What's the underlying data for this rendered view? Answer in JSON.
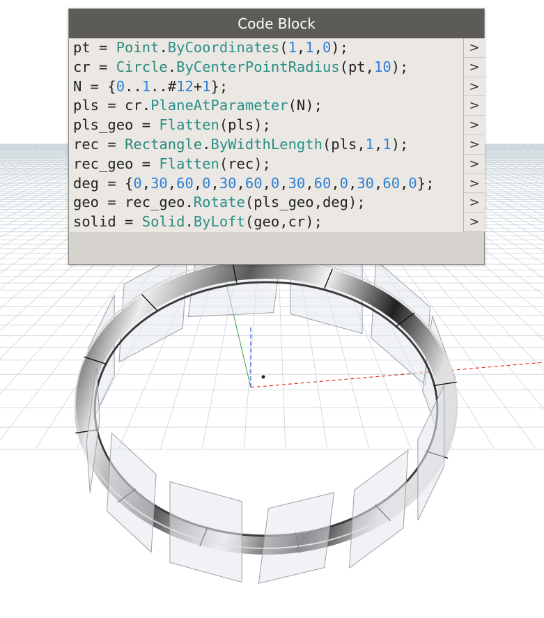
{
  "node": {
    "title": "Code Block",
    "lines": [
      [
        {
          "t": "pt = ",
          "c": "plain"
        },
        {
          "t": "Point",
          "c": "cls"
        },
        {
          "t": ".",
          "c": "plain"
        },
        {
          "t": "ByCoordinates",
          "c": "fn"
        },
        {
          "t": "(",
          "c": "plain"
        },
        {
          "t": "1",
          "c": "num"
        },
        {
          "t": ",",
          "c": "plain"
        },
        {
          "t": "1",
          "c": "num"
        },
        {
          "t": ",",
          "c": "plain"
        },
        {
          "t": "0",
          "c": "num"
        },
        {
          "t": ");",
          "c": "plain"
        }
      ],
      [
        {
          "t": "cr = ",
          "c": "plain"
        },
        {
          "t": "Circle",
          "c": "cls"
        },
        {
          "t": ".",
          "c": "plain"
        },
        {
          "t": "ByCenterPointRadius",
          "c": "fn"
        },
        {
          "t": "(pt,",
          "c": "plain"
        },
        {
          "t": "10",
          "c": "num"
        },
        {
          "t": ");",
          "c": "plain"
        }
      ],
      [
        {
          "t": "N = {",
          "c": "plain"
        },
        {
          "t": "0",
          "c": "num"
        },
        {
          "t": "..",
          "c": "plain"
        },
        {
          "t": "1",
          "c": "num"
        },
        {
          "t": "..#",
          "c": "plain"
        },
        {
          "t": "12",
          "c": "num"
        },
        {
          "t": "+",
          "c": "plain"
        },
        {
          "t": "1",
          "c": "num"
        },
        {
          "t": "};",
          "c": "plain"
        }
      ],
      [
        {
          "t": "pls = cr.",
          "c": "plain"
        },
        {
          "t": "PlaneAtParameter",
          "c": "fn"
        },
        {
          "t": "(N);",
          "c": "plain"
        }
      ],
      [
        {
          "t": "pls_geo = ",
          "c": "plain"
        },
        {
          "t": "Flatten",
          "c": "fn"
        },
        {
          "t": "(pls);",
          "c": "plain"
        }
      ],
      [
        {
          "t": "rec = ",
          "c": "plain"
        },
        {
          "t": "Rectangle",
          "c": "cls"
        },
        {
          "t": ".",
          "c": "plain"
        },
        {
          "t": "ByWidthLength",
          "c": "fn"
        },
        {
          "t": "(pls,",
          "c": "plain"
        },
        {
          "t": "1",
          "c": "num"
        },
        {
          "t": ",",
          "c": "plain"
        },
        {
          "t": "1",
          "c": "num"
        },
        {
          "t": ");",
          "c": "plain"
        }
      ],
      [
        {
          "t": "rec_geo = ",
          "c": "plain"
        },
        {
          "t": "Flatten",
          "c": "fn"
        },
        {
          "t": "(rec);",
          "c": "plain"
        }
      ],
      [
        {
          "t": "deg = {",
          "c": "plain"
        },
        {
          "t": "0",
          "c": "num"
        },
        {
          "t": ",",
          "c": "plain"
        },
        {
          "t": "30",
          "c": "num"
        },
        {
          "t": ",",
          "c": "plain"
        },
        {
          "t": "60",
          "c": "num"
        },
        {
          "t": ",",
          "c": "plain"
        },
        {
          "t": "0",
          "c": "num"
        },
        {
          "t": ",",
          "c": "plain"
        },
        {
          "t": "30",
          "c": "num"
        },
        {
          "t": ",",
          "c": "plain"
        },
        {
          "t": "60",
          "c": "num"
        },
        {
          "t": ",",
          "c": "plain"
        },
        {
          "t": "0",
          "c": "num"
        },
        {
          "t": ",",
          "c": "plain"
        },
        {
          "t": "30",
          "c": "num"
        },
        {
          "t": ",",
          "c": "plain"
        },
        {
          "t": "60",
          "c": "num"
        },
        {
          "t": ",",
          "c": "plain"
        },
        {
          "t": "0",
          "c": "num"
        },
        {
          "t": ",",
          "c": "plain"
        },
        {
          "t": "30",
          "c": "num"
        },
        {
          "t": ",",
          "c": "plain"
        },
        {
          "t": "60",
          "c": "num"
        },
        {
          "t": ",",
          "c": "plain"
        },
        {
          "t": "0",
          "c": "num"
        },
        {
          "t": "};",
          "c": "plain"
        }
      ],
      [
        {
          "t": "geo = rec_geo.",
          "c": "plain"
        },
        {
          "t": "Rotate",
          "c": "fn"
        },
        {
          "t": "(pls_geo,deg);",
          "c": "plain"
        }
      ],
      [
        {
          "t": "solid = ",
          "c": "plain"
        },
        {
          "t": "Solid",
          "c": "cls"
        },
        {
          "t": ".",
          "c": "plain"
        },
        {
          "t": "ByLoft",
          "c": "fn"
        },
        {
          "t": "(geo,cr);",
          "c": "plain"
        }
      ]
    ],
    "port_glyph": ">"
  },
  "viewport": {
    "panel_count": 12,
    "colors": {
      "background": "#ffffff",
      "grid": "#c9d4da",
      "ring_light": "#f2f2f2",
      "ring_dark": "#1c1c1c",
      "panel_fill": "#e4e8ec",
      "panel_stroke": "#9aa0a6",
      "axis_x": "#d9342b",
      "axis_y": "#3aa23a",
      "axis_z": "#2b4fd9"
    }
  }
}
